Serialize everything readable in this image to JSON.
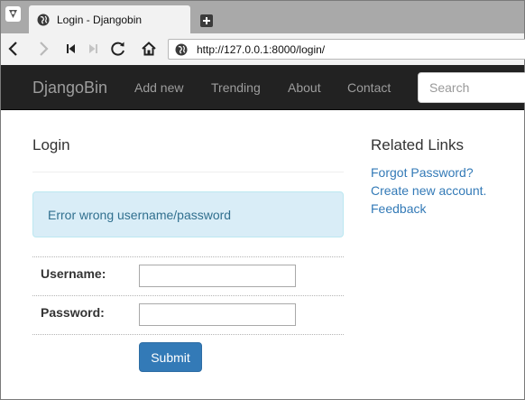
{
  "browser": {
    "tab_title": "Login - Djangobin",
    "url": "http://127.0.0.1:8000/login/"
  },
  "navbar": {
    "brand": "DjangoBin",
    "links": [
      "Add new",
      "Trending",
      "About",
      "Contact"
    ],
    "search_placeholder": "Search"
  },
  "main": {
    "title": "Login",
    "alert": "Error wrong username/password",
    "username_label": "Username:",
    "password_label": "Password:",
    "username_value": "",
    "password_value": "",
    "submit_label": "Submit"
  },
  "sidebar": {
    "title": "Related Links",
    "links": [
      "Forgot Password?",
      "Create new account.",
      "Feedback"
    ]
  },
  "colors": {
    "navbar_bg": "#222222",
    "link": "#337ab7",
    "alert_bg": "#d9edf7",
    "alert_text": "#31708f",
    "button_primary": "#337ab7"
  }
}
